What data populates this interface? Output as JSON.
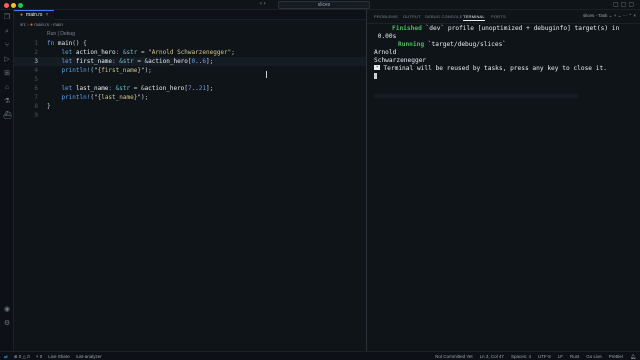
{
  "window": {
    "title": "slices"
  },
  "editor": {
    "tab_label": "main.rs",
    "breadcrumb": [
      "src",
      "main.rs",
      "main"
    ],
    "codelens": "Run | Debug",
    "line_numbers": [
      "1",
      "2",
      "3",
      "4",
      "5",
      "6",
      "7",
      "8",
      "9"
    ],
    "lines": [
      [
        [
          "k",
          "fn "
        ],
        [
          "f",
          "main"
        ],
        [
          "p",
          "() {"
        ]
      ],
      [
        [
          "k",
          "    let "
        ],
        [
          "f",
          "action_hero"
        ],
        [
          "t",
          ": &str"
        ],
        [
          "p",
          " = "
        ],
        [
          "s",
          "\"Arnold Schwarzenegger\""
        ],
        [
          "p",
          ";"
        ]
      ],
      [
        [
          "k",
          "    let "
        ],
        [
          "f",
          "first_name"
        ],
        [
          "t",
          ": &str"
        ],
        [
          "p",
          " = &"
        ],
        [
          "f",
          "action_hero"
        ],
        [
          "p",
          "["
        ],
        [
          "m",
          "0"
        ],
        [
          "p",
          ".."
        ],
        [
          "m",
          "6"
        ],
        [
          "p",
          "];"
        ]
      ],
      [
        [
          "m",
          "    println!"
        ],
        [
          "p",
          "(\""
        ],
        [
          "s",
          "{first_name}"
        ],
        [
          "p",
          "\");"
        ]
      ],
      [
        [
          "p",
          ""
        ]
      ],
      [
        [
          "k",
          "    let "
        ],
        [
          "f",
          "last_name"
        ],
        [
          "t",
          ": &str"
        ],
        [
          "p",
          " = &"
        ],
        [
          "f",
          "action_hero"
        ],
        [
          "p",
          "["
        ],
        [
          "m",
          "7"
        ],
        [
          "p",
          ".."
        ],
        [
          "m",
          "21"
        ],
        [
          "p",
          "];"
        ]
      ],
      [
        [
          "m",
          "    println!"
        ],
        [
          "p",
          "(\""
        ],
        [
          "s",
          "{last_name}"
        ],
        [
          "p",
          "\");"
        ]
      ],
      [
        [
          "p",
          "}"
        ]
      ],
      [
        [
          "p",
          ""
        ]
      ]
    ]
  },
  "panel": {
    "tabs": [
      "PROBLEMS",
      "OUTPUT",
      "DEBUG CONSOLE",
      "TERMINAL",
      "PORTS"
    ],
    "active_tab": "TERMINAL",
    "task_label": "slices - Task",
    "terminal": {
      "line1_status": "Finished",
      "line1_rest": " `dev` profile [unoptimized + debuginfo] target(s) in",
      "line2": " 0.00s",
      "line3_status": "Running",
      "line3_rest": " `target/debug/slices`",
      "line4": "Arnold",
      "line5": "Schwarzenegger",
      "line6_badge": "*",
      "line6": "Terminal will be reused by tasks, press any key to close it."
    }
  },
  "statusbar": {
    "left": [
      "⊗ 0 △ 0",
      "⑂ 0",
      "Live Share",
      "rust-analyzer"
    ],
    "right": [
      "Not Committed Yet",
      "Ln 3, Col 47",
      "Spaces: 4",
      "UTF-8",
      "LF",
      "Rust",
      "Go Live",
      "Prettier"
    ]
  },
  "icons": {
    "activity": [
      "files-icon",
      "search-icon",
      "source-control-icon",
      "run-debug-icon",
      "extensions-icon",
      "remote-icon",
      "testing-icon",
      "docker-icon",
      "account-icon",
      "settings-icon"
    ]
  },
  "colors": {
    "background": "#0f1419",
    "keyword": "#5ea2e8",
    "string": "#d4c58a",
    "success": "#4dbb5f",
    "accent": "#3b82f6"
  }
}
